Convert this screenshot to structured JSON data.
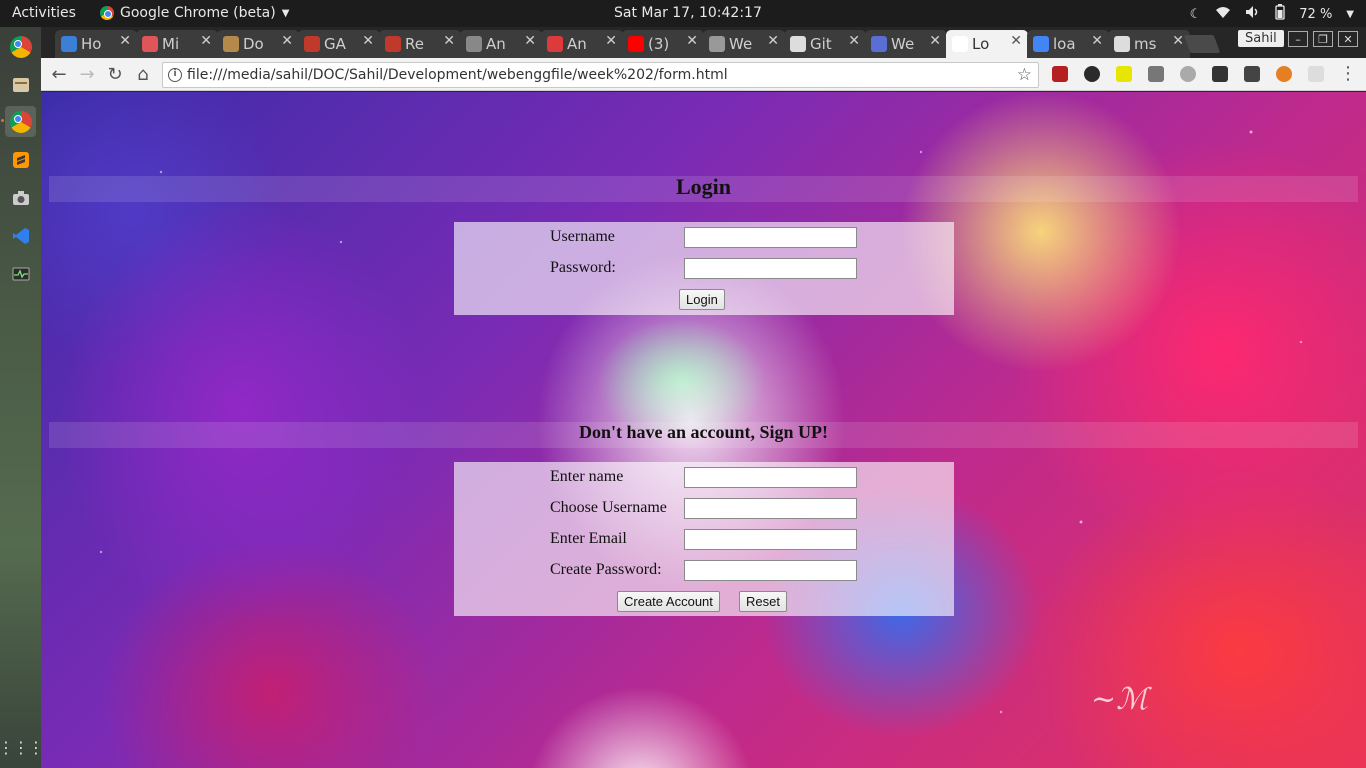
{
  "topbar": {
    "activities": "Activities",
    "app_name": "Google Chrome (beta)",
    "clock": "Sat Mar 17, 10:42:17",
    "battery": "72 %"
  },
  "browser": {
    "tabs": [
      {
        "label": "Ho",
        "favicon_color": "#3b7fd6"
      },
      {
        "label": "Mi",
        "favicon_color": "#e0555a"
      },
      {
        "label": "Do",
        "favicon_color": "#b48a4a"
      },
      {
        "label": "GA",
        "favicon_color": "#c0392b"
      },
      {
        "label": "Re",
        "favicon_color": "#c0392b"
      },
      {
        "label": "An",
        "favicon_color": "#888888"
      },
      {
        "label": "An",
        "favicon_color": "#dd3b3b"
      },
      {
        "label": "(3)",
        "favicon_color": "#ff0000"
      },
      {
        "label": "We",
        "favicon_color": "#999999"
      },
      {
        "label": "Git",
        "favicon_color": "#dddddd"
      },
      {
        "label": "We",
        "favicon_color": "#5a6fd6"
      },
      {
        "label": "Lo",
        "favicon_color": "#ffffff"
      },
      {
        "label": "loa",
        "favicon_color": "#4285f4"
      },
      {
        "label": "ms",
        "favicon_color": "#dddddd"
      }
    ],
    "active_tab_index": 11,
    "profile_name": "Sahil",
    "url": "file:///media/sahil/DOC/Sahil/Development/webenggfile/week%202/form.html"
  },
  "page": {
    "login": {
      "heading": "Login",
      "username_label": "Username",
      "password_label": "Password:",
      "login_button": "Login"
    },
    "signup": {
      "heading": "Don't have an account, Sign UP!",
      "name_label": "Enter name",
      "username_label": "Choose Username",
      "email_label": "Enter Email",
      "password_label": "Create Password:",
      "create_button": "Create Account",
      "reset_button": "Reset"
    }
  }
}
